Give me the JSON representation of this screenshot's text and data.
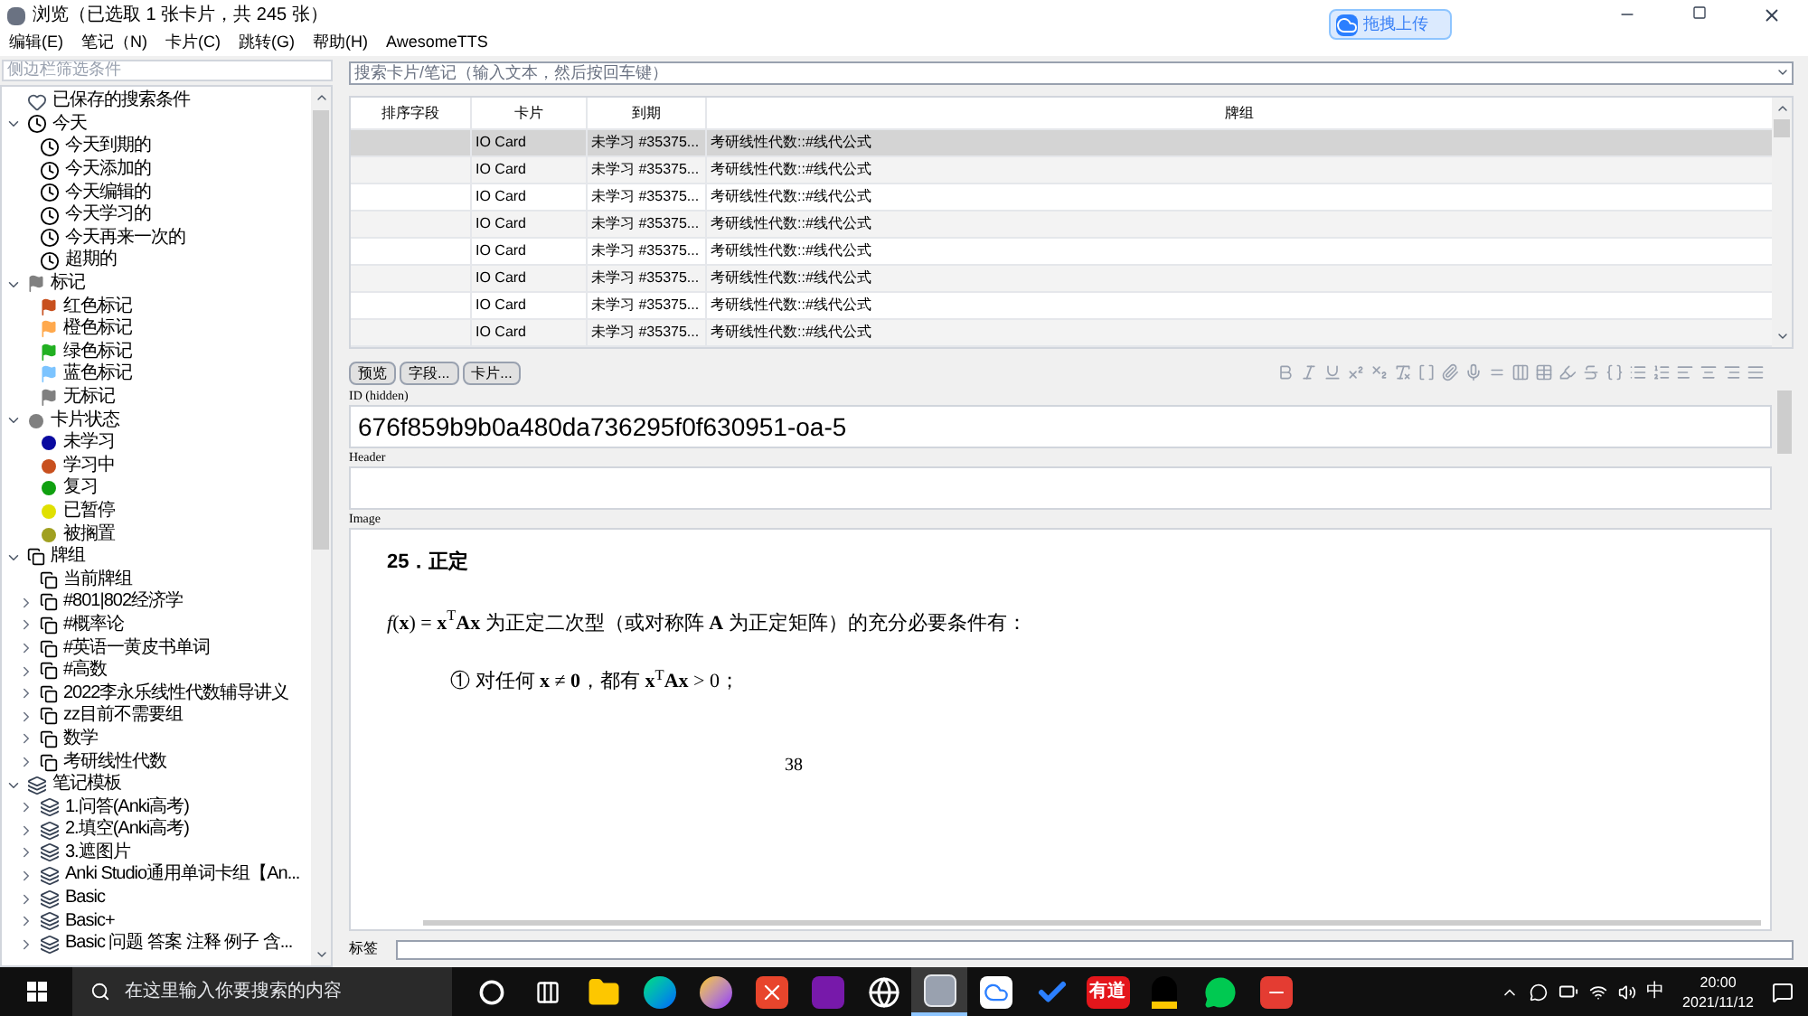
{
  "window": {
    "title": "浏览（已选取 1 张卡片，共 245 张）",
    "upload_button": "拖拽上传"
  },
  "menu": [
    "编辑(E)",
    "笔记（N)",
    "卡片(C)",
    "跳转(G)",
    "帮助(H)",
    "AwesomeTTS"
  ],
  "sidebar": {
    "filter_placeholder": "侧边栏筛选条件",
    "items": [
      {
        "kind": "heart",
        "label": "已保存的搜索条件"
      },
      {
        "kind": "clock",
        "label": "今天",
        "expanded": true,
        "children": [
          {
            "kind": "clock",
            "label": "今天到期的"
          },
          {
            "kind": "clock",
            "label": "今天添加的"
          },
          {
            "kind": "clock",
            "label": "今天编辑的"
          },
          {
            "kind": "clock",
            "label": "今天学习的"
          },
          {
            "kind": "clock",
            "label": "今天再来一次的"
          },
          {
            "kind": "clock",
            "label": "超期的"
          }
        ]
      },
      {
        "kind": "flag",
        "color": "#808080",
        "label": "标记",
        "expanded": true,
        "children": [
          {
            "kind": "flag",
            "color": "#c8501e",
            "label": "红色标记"
          },
          {
            "kind": "flag",
            "color": "#ffa94d",
            "label": "橙色标记"
          },
          {
            "kind": "flag",
            "color": "#22b022",
            "label": "绿色标记"
          },
          {
            "kind": "flag",
            "color": "#7cc4ff",
            "label": "蓝色标记"
          },
          {
            "kind": "flag",
            "color": "#808080",
            "label": "无标记"
          }
        ]
      },
      {
        "kind": "dot",
        "color": "#808080",
        "label": "卡片状态",
        "expanded": true,
        "children": [
          {
            "kind": "dot",
            "color": "#0a0aa0",
            "label": "未学习"
          },
          {
            "kind": "dot",
            "color": "#c8501e",
            "label": "学习中"
          },
          {
            "kind": "dot",
            "color": "#10a010",
            "label": "复习"
          },
          {
            "kind": "dot",
            "color": "#e0e000",
            "label": "已暂停"
          },
          {
            "kind": "dot",
            "color": "#a0a020",
            "label": "被搁置"
          }
        ]
      },
      {
        "kind": "deck",
        "label": "牌组",
        "expanded": true,
        "children": [
          {
            "kind": "deck",
            "label": "当前牌组"
          },
          {
            "kind": "deck",
            "label": "#801|802经济学",
            "expanded": false
          },
          {
            "kind": "deck",
            "label": "#概率论",
            "expanded": false
          },
          {
            "kind": "deck",
            "label": "#英语一黄皮书单词",
            "expanded": false
          },
          {
            "kind": "deck",
            "label": "#高数",
            "expanded": false
          },
          {
            "kind": "deck",
            "label": "2022李永乐线性代数辅导讲义",
            "expanded": false
          },
          {
            "kind": "deck",
            "label": "zz目前不需要组",
            "expanded": false
          },
          {
            "kind": "deck",
            "label": "数学",
            "expanded": false
          },
          {
            "kind": "deck",
            "label": "考研线性代数",
            "expanded": false
          }
        ]
      },
      {
        "kind": "notetype",
        "label": "笔记模板",
        "expanded": true,
        "children": [
          {
            "kind": "notetype",
            "label": "1.问答(Anki高考)",
            "expanded": false
          },
          {
            "kind": "notetype",
            "label": "2.填空(Anki高考)",
            "expanded": false
          },
          {
            "kind": "notetype",
            "label": "3.遮图片",
            "expanded": false
          },
          {
            "kind": "notetype",
            "label": "Anki Studio通用单词卡组【An...",
            "expanded": false
          },
          {
            "kind": "notetype",
            "label": "Basic",
            "expanded": false
          },
          {
            "kind": "notetype",
            "label": "Basic+",
            "expanded": false
          },
          {
            "kind": "notetype",
            "label": "Basic 问题 答案 注释 例子 含...",
            "expanded": false
          }
        ]
      }
    ]
  },
  "search": {
    "placeholder": "搜索卡片/笔记（输入文本，然后按回车键）"
  },
  "table": {
    "columns": [
      "排序字段",
      "卡片",
      "到期",
      "牌组"
    ],
    "rows": [
      {
        "selected": true,
        "card": "IO Card",
        "due": "未学习 #35375...",
        "deck": "考研线性代数::#线代公式"
      },
      {
        "selected": false,
        "card": "IO Card",
        "due": "未学习 #35375...",
        "deck": "考研线性代数::#线代公式"
      },
      {
        "selected": false,
        "card": "IO Card",
        "due": "未学习 #35375...",
        "deck": "考研线性代数::#线代公式"
      },
      {
        "selected": false,
        "card": "IO Card",
        "due": "未学习 #35375...",
        "deck": "考研线性代数::#线代公式"
      },
      {
        "selected": false,
        "card": "IO Card",
        "due": "未学习 #35375...",
        "deck": "考研线性代数::#线代公式"
      },
      {
        "selected": false,
        "card": "IO Card",
        "due": "未学习 #35375...",
        "deck": "考研线性代数::#线代公式"
      },
      {
        "selected": false,
        "card": "IO Card",
        "due": "未学习 #35375...",
        "deck": "考研线性代数::#线代公式"
      },
      {
        "selected": false,
        "card": "IO Card",
        "due": "未学习 #35375...",
        "deck": "考研线性代数::#线代公式"
      }
    ]
  },
  "editor": {
    "buttons": [
      "预览",
      "字段...",
      "卡片..."
    ],
    "fields": [
      {
        "label": "ID (hidden)",
        "value": "676f859b9b0a480da736295f0f630951-oa-5"
      },
      {
        "label": "Header"
      },
      {
        "label": "Image",
        "document": {
          "heading": "25．正定",
          "formula": "*f*(**x**) = **x**$^{T}$**Ax** 为正定二次型（或对称阵 **A** 为正定矩阵）的充分必要条件有：",
          "item": "①  对任何 **x** ≠ **0**，都有 **x**$^{T}$**Ax** > 0；",
          "page": "38"
        }
      }
    ],
    "tags_label": "标签"
  },
  "taskbar": {
    "search_placeholder": "在这里输入你要搜索的内容",
    "apps": [
      {
        "kind": "cortana",
        "selected": false
      },
      {
        "kind": "taskview",
        "selected": false
      },
      {
        "kind": "explorer",
        "selected": false
      },
      {
        "kind": "edge",
        "selected": false
      },
      {
        "kind": "firefox",
        "selected": false
      },
      {
        "kind": "xmind",
        "selected": false
      },
      {
        "kind": "onenote",
        "selected": false
      },
      {
        "kind": "hub",
        "selected": false
      },
      {
        "kind": "anki",
        "selected": true
      },
      {
        "kind": "cloud",
        "selected": false
      },
      {
        "kind": "todo",
        "selected": false
      },
      {
        "kind": "youdao",
        "selected": false,
        "label": "有道"
      },
      {
        "kind": "qq",
        "selected": false
      },
      {
        "kind": "wechat",
        "selected": false
      },
      {
        "kind": "wps",
        "selected": false
      }
    ],
    "ime": "中",
    "time": "20:00",
    "date": "2021/11/12"
  }
}
